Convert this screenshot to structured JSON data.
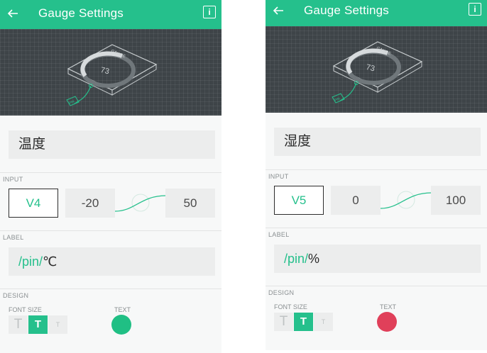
{
  "screens": [
    {
      "title": "Gauge Settings",
      "info_label": "i",
      "preview": {
        "widget_label": "GAUGE",
        "value": "73",
        "pin_tag": "PIN"
      },
      "name": "温度",
      "input": {
        "section": "INPUT",
        "pin": "V4",
        "min": "-20",
        "max": "50"
      },
      "label": {
        "section": "LABEL",
        "pin_part": "/pin/",
        "suffix": "℃"
      },
      "design": {
        "section": "DESIGN",
        "font_size_label": "FONT SIZE",
        "font_sizes": [
          "T",
          "T",
          "T"
        ],
        "selected_font_size": 1,
        "text_label": "TEXT",
        "text_color": "#20bf84"
      }
    },
    {
      "title": "Gauge Settings",
      "info_label": "i",
      "preview": {
        "widget_label": "GAUGE",
        "value": "73",
        "pin_tag": "PIN"
      },
      "name": "湿度",
      "input": {
        "section": "INPUT",
        "pin": "V5",
        "min": "0",
        "max": "100"
      },
      "label": {
        "section": "LABEL",
        "pin_part": "/pin/",
        "suffix": "%"
      },
      "design": {
        "section": "DESIGN",
        "font_size_label": "FONT SIZE",
        "font_sizes": [
          "T",
          "T",
          "T"
        ],
        "selected_font_size": 1,
        "text_label": "TEXT",
        "text_color": "#e0405a"
      }
    }
  ],
  "theme": {
    "accent": "#25c08c",
    "preview_bg": "#3e4448"
  }
}
